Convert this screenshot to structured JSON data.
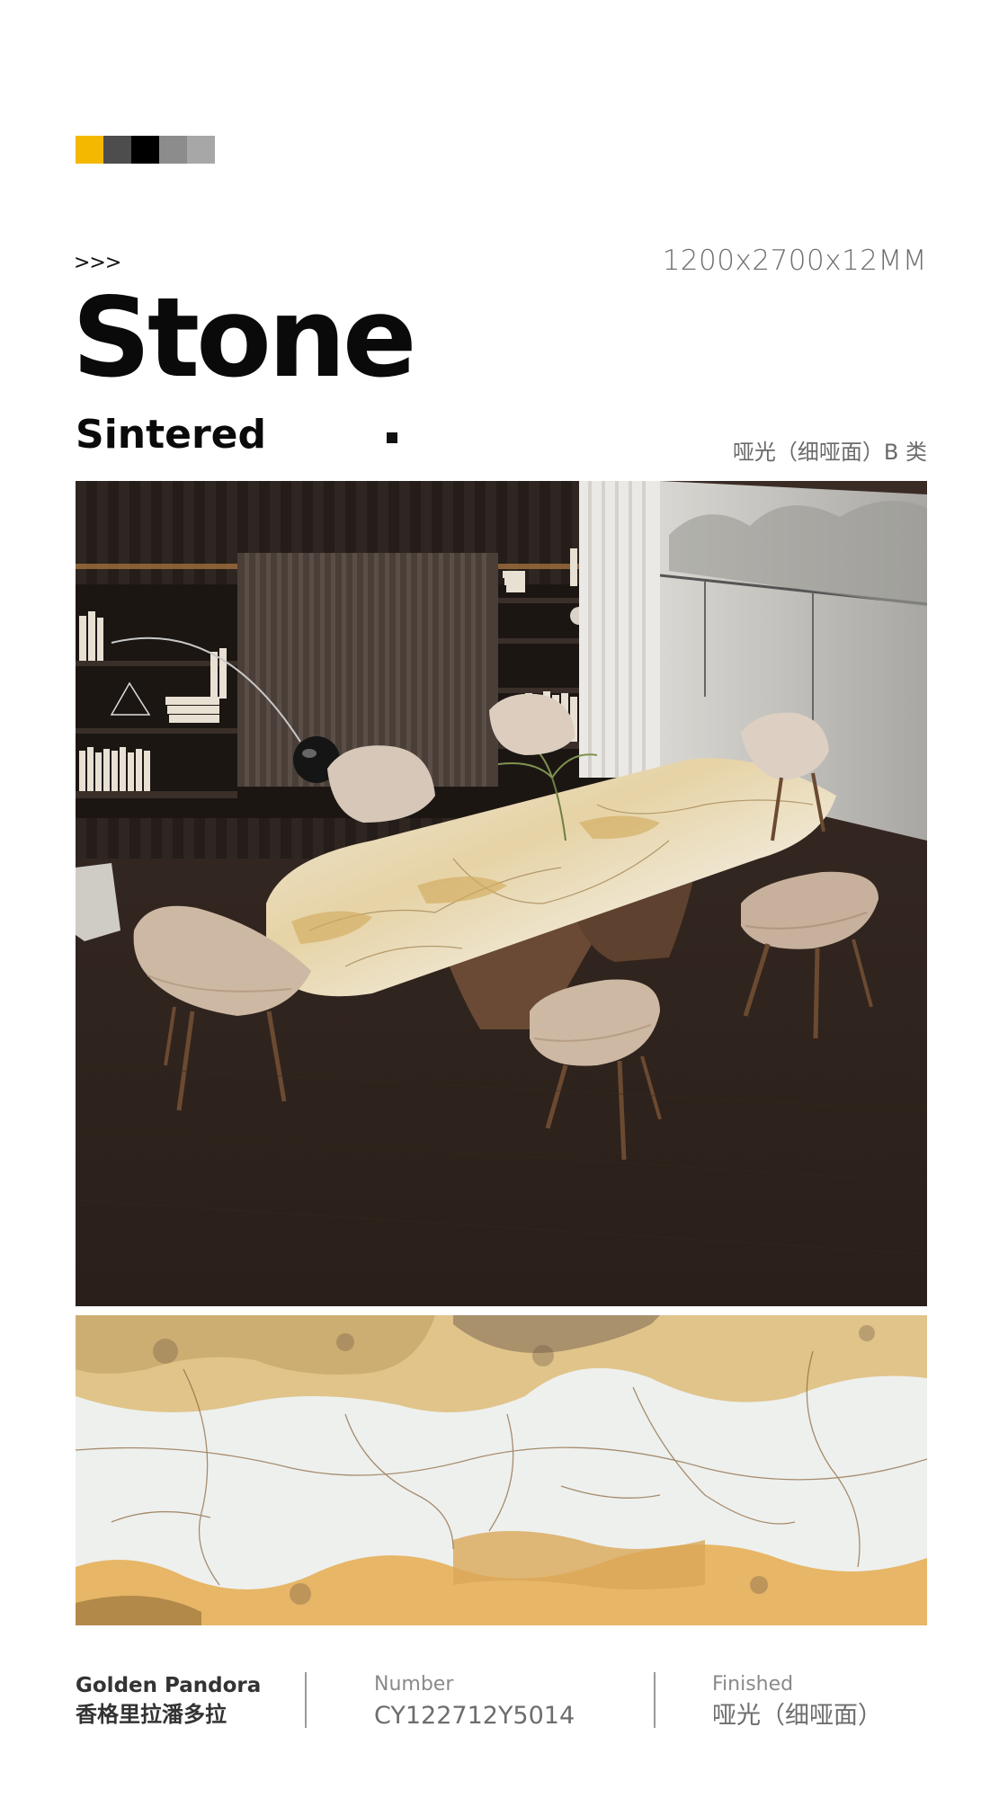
{
  "palette": [
    "#f5b800",
    "#4d4d4d",
    "#000000",
    "#8c8c8c",
    "#a7a7a7"
  ],
  "header": {
    "arrows": ">>>",
    "dimensions": "1200x2700x12MM",
    "title": "Stone",
    "subtitle": "Sintered",
    "finish_top": "哑光（细哑面）B 类"
  },
  "footer": {
    "name_en": "Golden Pandora",
    "name_cn": "香格里拉潘多拉",
    "number_label": "Number",
    "number_value": "CY122712Y5014",
    "finished_label": "Finished",
    "finished_value": "哑光（细哑面）"
  }
}
